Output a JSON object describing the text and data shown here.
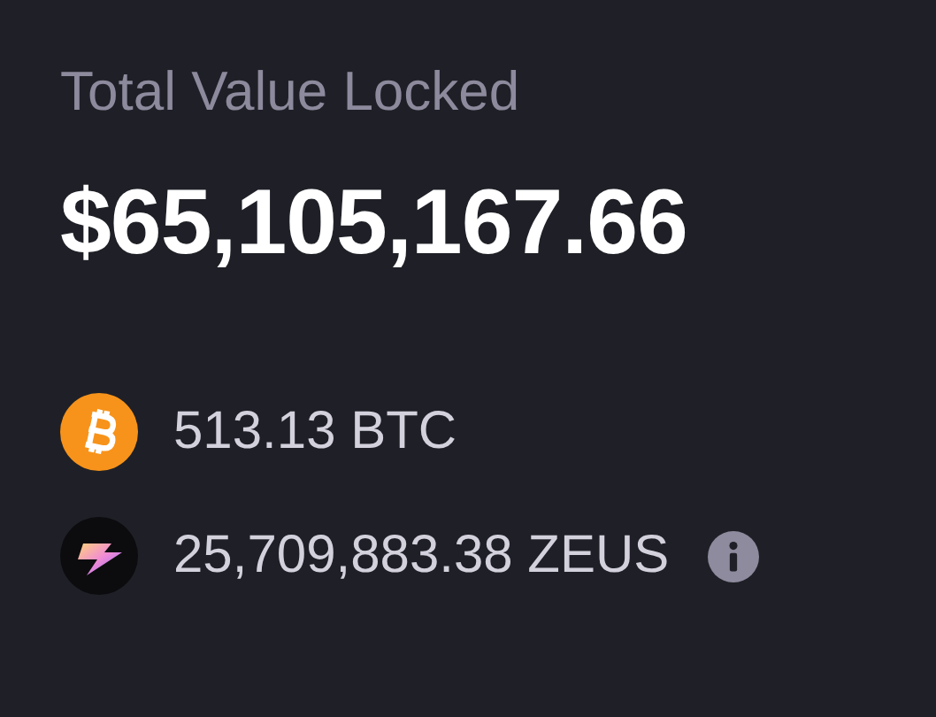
{
  "title": "Total Value Locked",
  "total": "$65,105,167.66",
  "assets": [
    {
      "kind": "btc",
      "amount": "513.13 BTC",
      "info": false
    },
    {
      "kind": "zeus",
      "amount": "25,709,883.38 ZEUS",
      "info": true
    }
  ]
}
